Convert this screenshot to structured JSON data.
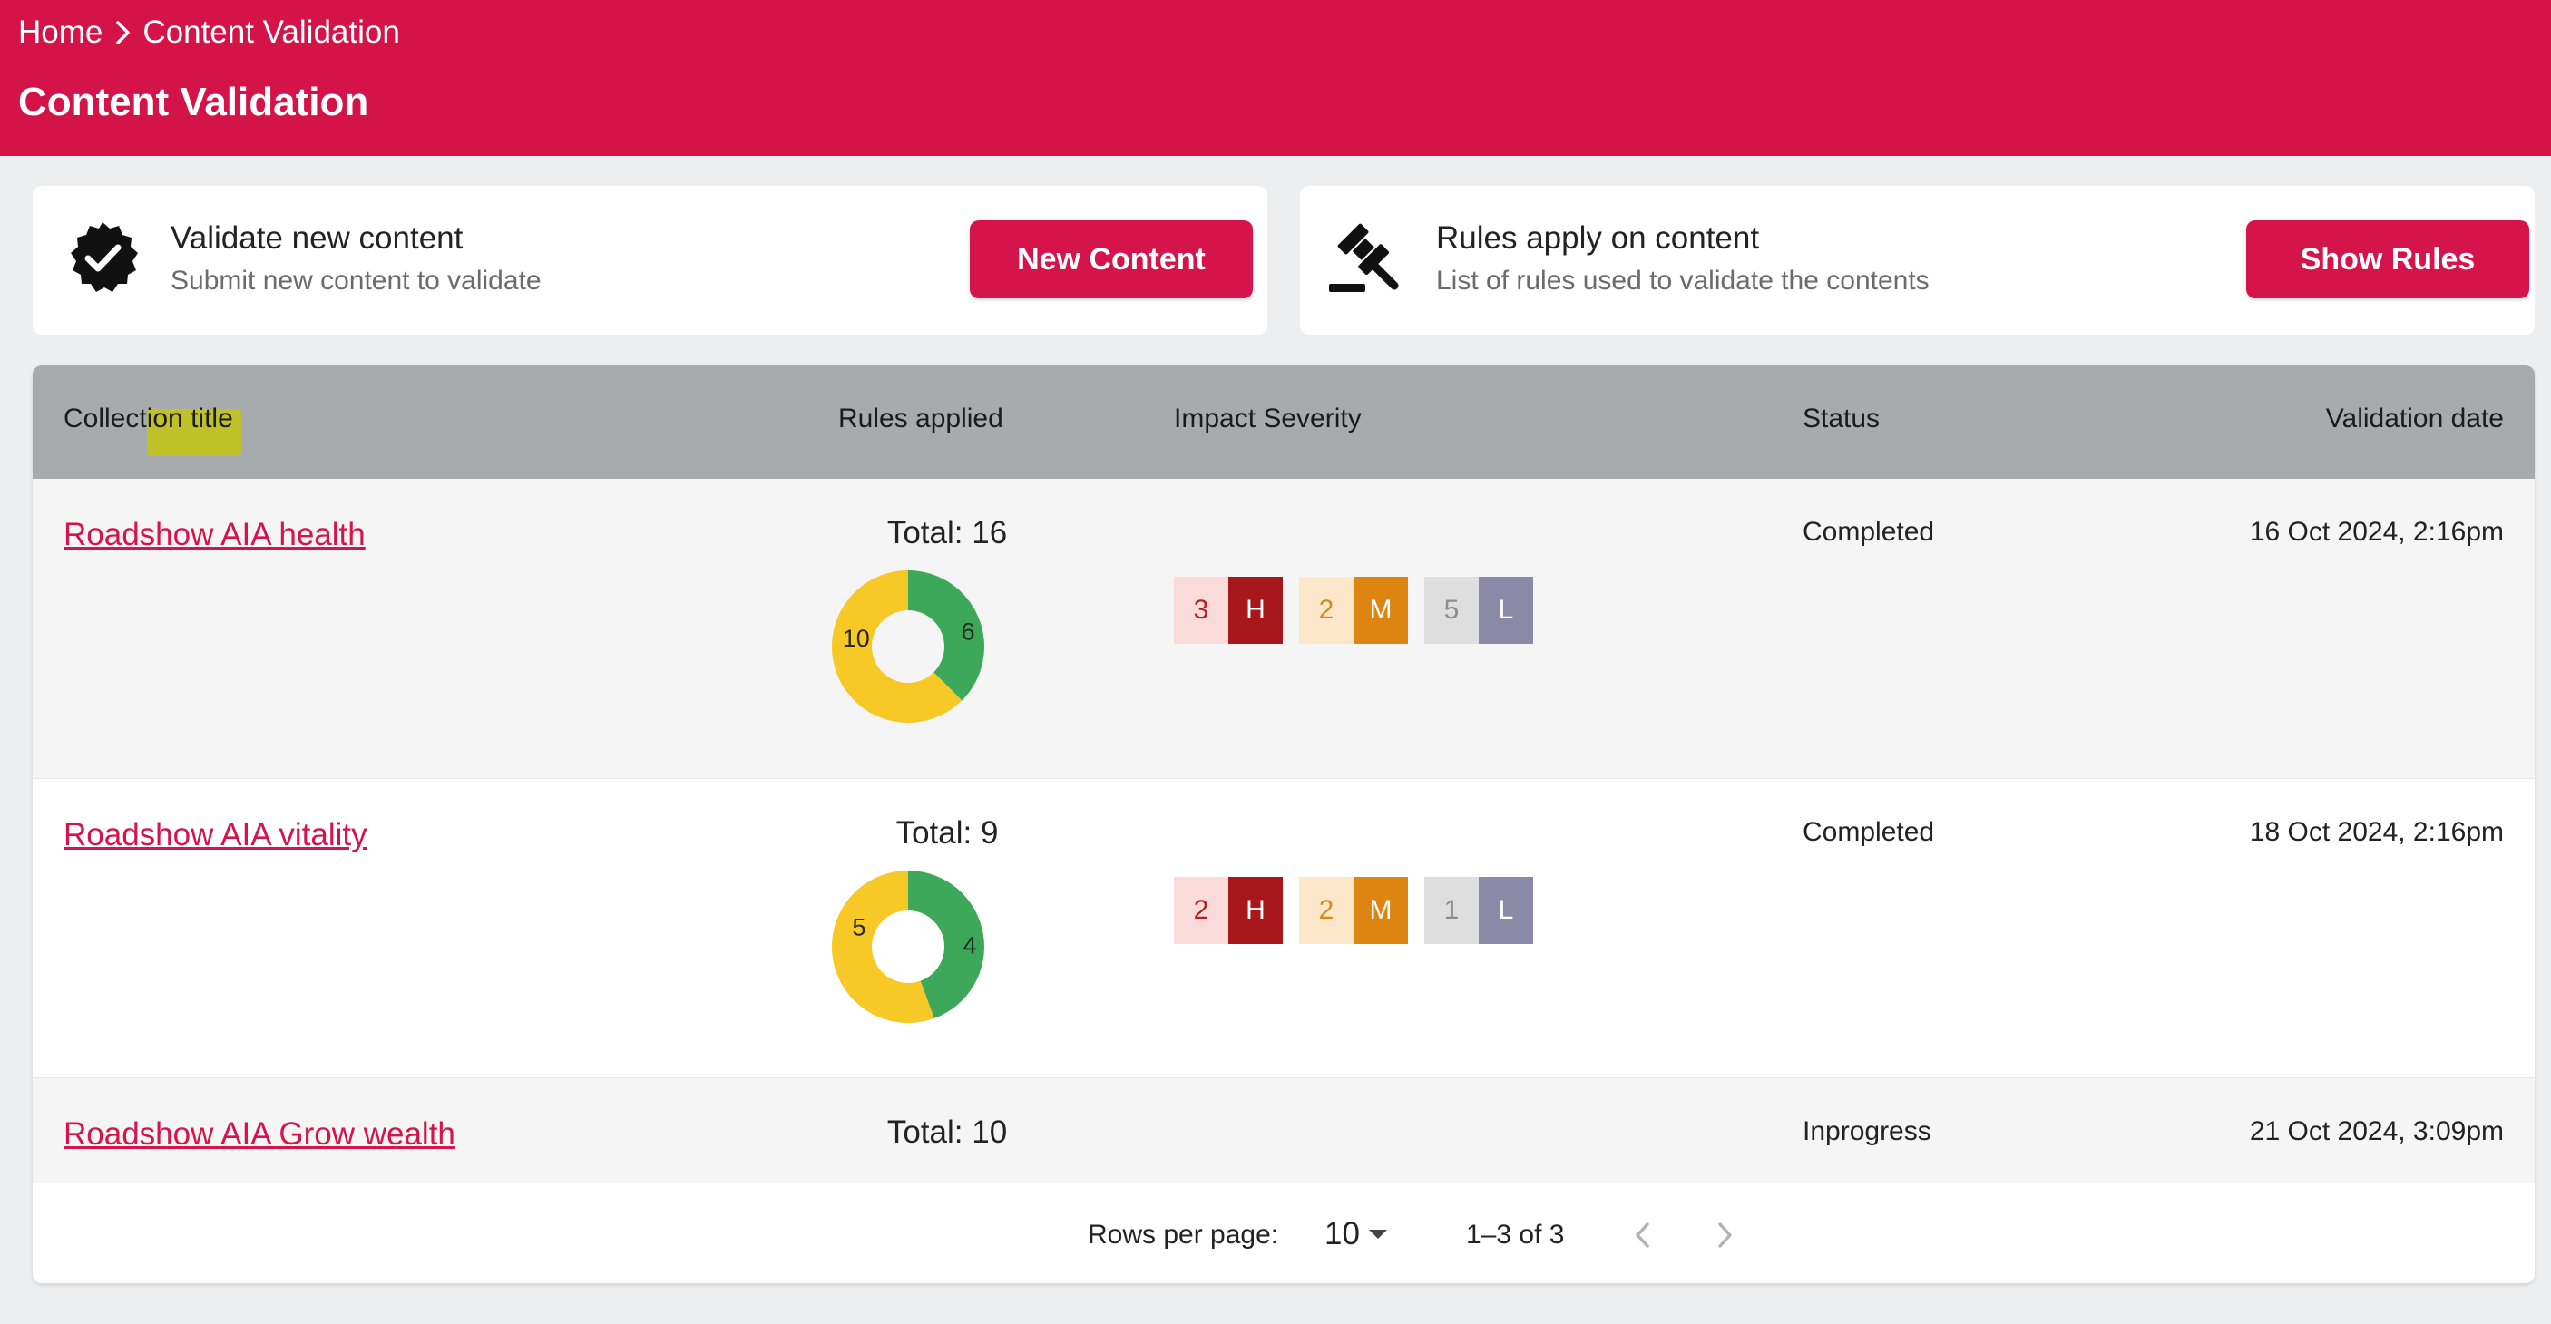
{
  "breadcrumb": {
    "home": "Home",
    "current": "Content Validation"
  },
  "page_title": "Content Validation",
  "cards": {
    "validate": {
      "title": "Validate new content",
      "subtitle": "Submit new content to validate",
      "button": "New Content"
    },
    "rules": {
      "title": "Rules apply on content",
      "subtitle": "List of rules used to validate the contents",
      "button": "Show Rules"
    }
  },
  "table": {
    "headers": {
      "title": "Collection title",
      "rules": "Rules applied",
      "severity": "Impact Severity",
      "status": "Status",
      "date": "Validation date"
    },
    "rows": [
      {
        "title": "Roadshow AIA health",
        "total": "Total: 16",
        "passed": 6,
        "failed": 10,
        "passed_label": "6",
        "failed_label": "10",
        "sev": {
          "h": "3",
          "m": "2",
          "l": "5"
        },
        "status": "Completed",
        "date": "16 Oct 2024, 2:16pm"
      },
      {
        "title": "Roadshow AIA vitality",
        "total": "Total: 9",
        "passed": 4,
        "failed": 5,
        "passed_label": "4",
        "failed_label": "5",
        "sev": {
          "h": "2",
          "m": "2",
          "l": "1"
        },
        "status": "Completed",
        "date": "18 Oct 2024, 2:16pm"
      },
      {
        "title": "Roadshow AIA Grow wealth",
        "total": "Total: 10",
        "status": "Inprogress",
        "date": "21 Oct 2024, 3:09pm"
      }
    ],
    "severity_letters": {
      "h": "H",
      "m": "M",
      "l": "L"
    }
  },
  "pagination": {
    "rows_label": "Rows per page:",
    "rows_value": "10",
    "range": "1–3 of 3"
  },
  "colors": {
    "brand": "#d41448",
    "donut_pass": "#3ea85a",
    "donut_fail": "#f7c926"
  },
  "icons": {
    "validate": "verified-badge-icon",
    "rules": "gavel-icon",
    "sep": "chevron-right-icon",
    "prev": "chevron-left-icon",
    "next": "chevron-right-icon"
  }
}
